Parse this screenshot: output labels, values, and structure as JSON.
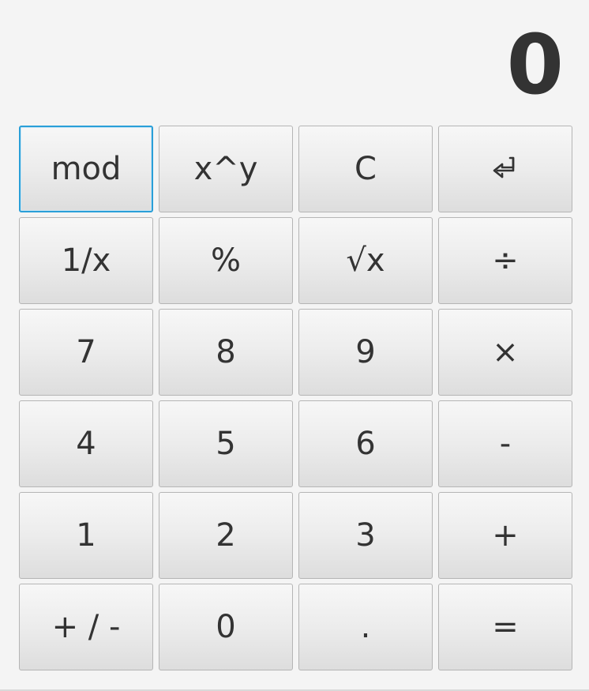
{
  "display": {
    "value": "0"
  },
  "keys": {
    "mod": "mod",
    "pow": "x^y",
    "clear": "C",
    "backspace_icon": "return-arrow-icon",
    "reciprocal": "1/x",
    "percent": "%",
    "sqrt": "√x",
    "divide": "÷",
    "seven": "7",
    "eight": "8",
    "nine": "9",
    "multiply": "×",
    "four": "4",
    "five": "5",
    "six": "6",
    "minus": "-",
    "one": "1",
    "two": "2",
    "three": "3",
    "plus": "+",
    "negate": "+ / -",
    "zero": "0",
    "decimal": ".",
    "equals": "="
  },
  "colors": {
    "background": "#f4f4f4",
    "text": "#333333",
    "focus_border": "#2a9fd8",
    "key_border": "#b5b5b5"
  }
}
